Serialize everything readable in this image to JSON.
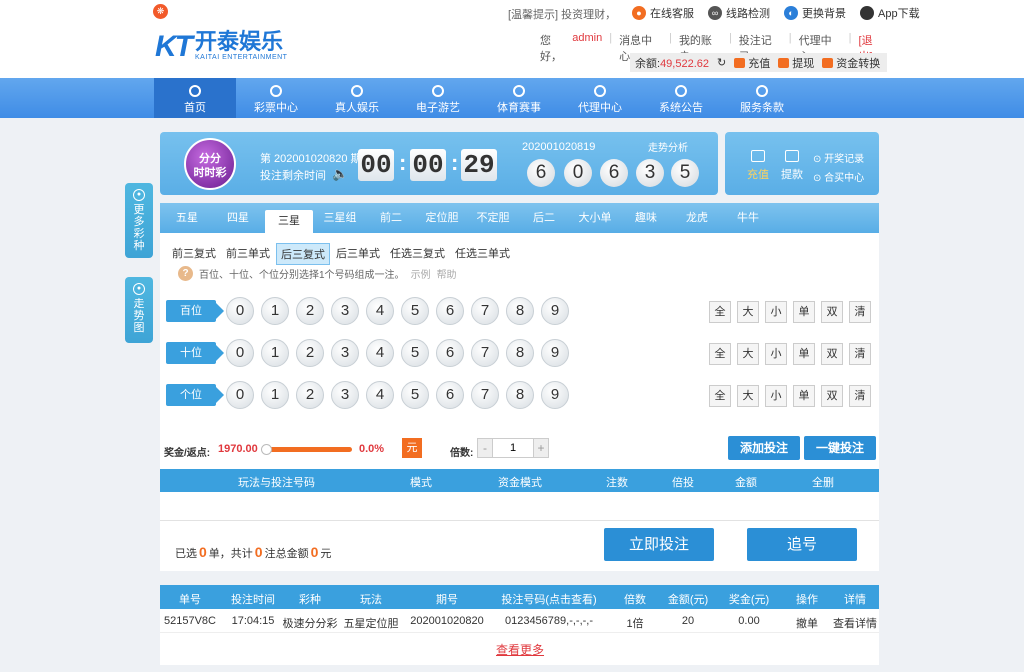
{
  "header": {
    "logo_k": "KT",
    "logo_cn": "开泰娱乐",
    "logo_en": "KAITAI ENTERTAINMENT",
    "tip": "[温馨提示] 投资理财，",
    "links": [
      "在线客服",
      "线路检测",
      "更换背景",
      "App下载"
    ],
    "greeting": "您好，",
    "username": "admin",
    "user_links": [
      "消息中心",
      "我的账户",
      "投注记录",
      "代理中心"
    ],
    "logout": "[退出]",
    "balance_label": "余额:",
    "balance_value": "49,522.62",
    "refresh_icon": "↻",
    "actions": [
      "充值",
      "提现",
      "资金转换"
    ]
  },
  "nav": {
    "items": [
      "首页",
      "彩票中心",
      "真人娱乐",
      "电子游艺",
      "体育赛事",
      "代理中心",
      "系统公告",
      "服务条款"
    ]
  },
  "side": {
    "more": [
      "更",
      "多",
      "彩",
      "种"
    ],
    "trend": [
      "走",
      "势",
      "图"
    ]
  },
  "hero": {
    "game_logo": [
      "分分",
      "时时彩"
    ],
    "issue": "第 202001020820 期",
    "remain_label": "投注剩余时间",
    "speaker_icon": "🔈",
    "countdown": [
      "00",
      "00",
      "29"
    ],
    "prev_issue": "202001020819",
    "trend_label": "走势分析",
    "balls": [
      "6",
      "0",
      "6",
      "3",
      "5"
    ],
    "recharge": "充值",
    "withdraw": "提款",
    "draw_record": "开奖记录",
    "contract_center": "合买中心"
  },
  "tabs": [
    "五星",
    "四星",
    "三星",
    "三星组",
    "前二",
    "定位胆",
    "不定胆",
    "后二",
    "大小单",
    "趣味",
    "龙虎",
    "牛牛"
  ],
  "subtabs": [
    "前三复式",
    "前三单式",
    "后三复式",
    "后三单式",
    "任选三复式",
    "任选三单式"
  ],
  "hint": {
    "q": "?",
    "text": "百位、十位、个位分别选择1个号码组成一注。",
    "example": "示例",
    "help": "帮助"
  },
  "rows": [
    "百位",
    "十位",
    "个位"
  ],
  "numbers": [
    "0",
    "1",
    "2",
    "3",
    "4",
    "5",
    "6",
    "7",
    "8",
    "9"
  ],
  "quick": [
    "全",
    "大",
    "小",
    "单",
    "双",
    "清"
  ],
  "controls": {
    "rebate_label": "奖金/返点:",
    "rebate_value": "1970.00",
    "rebate_pct": "0.0%",
    "rebate_fraction": 0,
    "unit": "元",
    "multiple_label": "倍数:",
    "multiple_value": "1",
    "minus": "-",
    "plus": "+",
    "add_bet": "添加投注",
    "quick_bet": "一键投注"
  },
  "bet_table": {
    "headers": [
      "玩法与投注号码",
      "模式",
      "资金模式",
      "注数",
      "倍投",
      "金额",
      "全删"
    ]
  },
  "summary": {
    "selected": "已选",
    "count": "0",
    "unit1": "单，共计",
    "bets": "0",
    "unit2": "注总金额",
    "amount": "0",
    "unit3": "元",
    "submit": "立即投注",
    "chase": "追号"
  },
  "records": {
    "headers": [
      "单号",
      "投注时间",
      "彩种",
      "玩法",
      "期号",
      "投注号码(点击查看)",
      "倍数",
      "金额(元)",
      "奖金(元)",
      "操作",
      "详情"
    ],
    "rows": [
      [
        "52157V8C",
        "17:04:15",
        "极速分分彩",
        "五星定位胆",
        "202001020820",
        "0123456789,-,-,-,-",
        "1倍",
        "20",
        "0.00",
        "撤单",
        "查看详情"
      ]
    ],
    "more": "查看更多"
  },
  "colors": {
    "brand": "#1f77d6",
    "accent": "#f26d21",
    "nav": "#3f8ce6"
  }
}
